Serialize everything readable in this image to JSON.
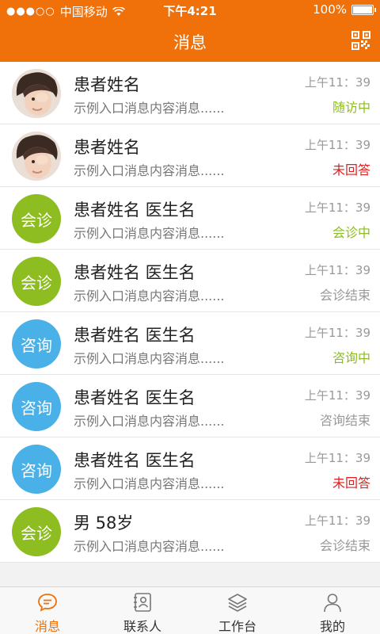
{
  "status_bar": {
    "signal": "●●●○○",
    "carrier": "中国移动",
    "time": "下午4:21",
    "battery": "100%"
  },
  "nav": {
    "title": "消息"
  },
  "messages": [
    {
      "name": "患者姓名",
      "preview": "示例入口消息内容消息......",
      "time": "上午11：39",
      "status": "随访中",
      "status_color": "#8dbd20",
      "avatar_type": "photo",
      "avatar_label": ""
    },
    {
      "name": "患者姓名",
      "preview": "示例入口消息内容消息......",
      "time": "上午11：39",
      "status": "未回答",
      "status_color": "#e02020",
      "avatar_type": "photo",
      "avatar_label": ""
    },
    {
      "name": "患者姓名 医生名",
      "preview": "示例入口消息内容消息......",
      "time": "上午11：39",
      "status": "会诊中",
      "status_color": "#8dbd20",
      "avatar_type": "green",
      "avatar_label": "会诊"
    },
    {
      "name": "患者姓名 医生名",
      "preview": "示例入口消息内容消息......",
      "time": "上午11：39",
      "status": "会诊结束",
      "status_color": "#999999",
      "avatar_type": "green",
      "avatar_label": "会诊"
    },
    {
      "name": "患者姓名 医生名",
      "preview": "示例入口消息内容消息......",
      "time": "上午11：39",
      "status": "咨询中",
      "status_color": "#8dbd20",
      "avatar_type": "blue",
      "avatar_label": "咨询"
    },
    {
      "name": "患者姓名 医生名",
      "preview": "示例入口消息内容消息......",
      "time": "上午11：39",
      "status": "咨询结束",
      "status_color": "#999999",
      "avatar_type": "blue",
      "avatar_label": "咨询"
    },
    {
      "name": "患者姓名 医生名",
      "preview": "示例入口消息内容消息......",
      "time": "上午11：39",
      "status": "未回答",
      "status_color": "#e02020",
      "avatar_type": "blue",
      "avatar_label": "咨询"
    },
    {
      "name": "男 58岁",
      "preview": "示例入口消息内容消息......",
      "time": "上午11：39",
      "status": "会诊结束",
      "status_color": "#999999",
      "avatar_type": "green",
      "avatar_label": "会诊"
    }
  ],
  "tabs": [
    {
      "label": "消息",
      "icon": "chat-bubble-icon",
      "active": true
    },
    {
      "label": "联系人",
      "icon": "contacts-icon",
      "active": false
    },
    {
      "label": "工作台",
      "icon": "layers-icon",
      "active": false
    },
    {
      "label": "我的",
      "icon": "person-icon",
      "active": false
    }
  ],
  "colors": {
    "accent": "#f0700a",
    "consult_green": "#8dbd20",
    "inquiry_blue": "#4ab0e8"
  }
}
